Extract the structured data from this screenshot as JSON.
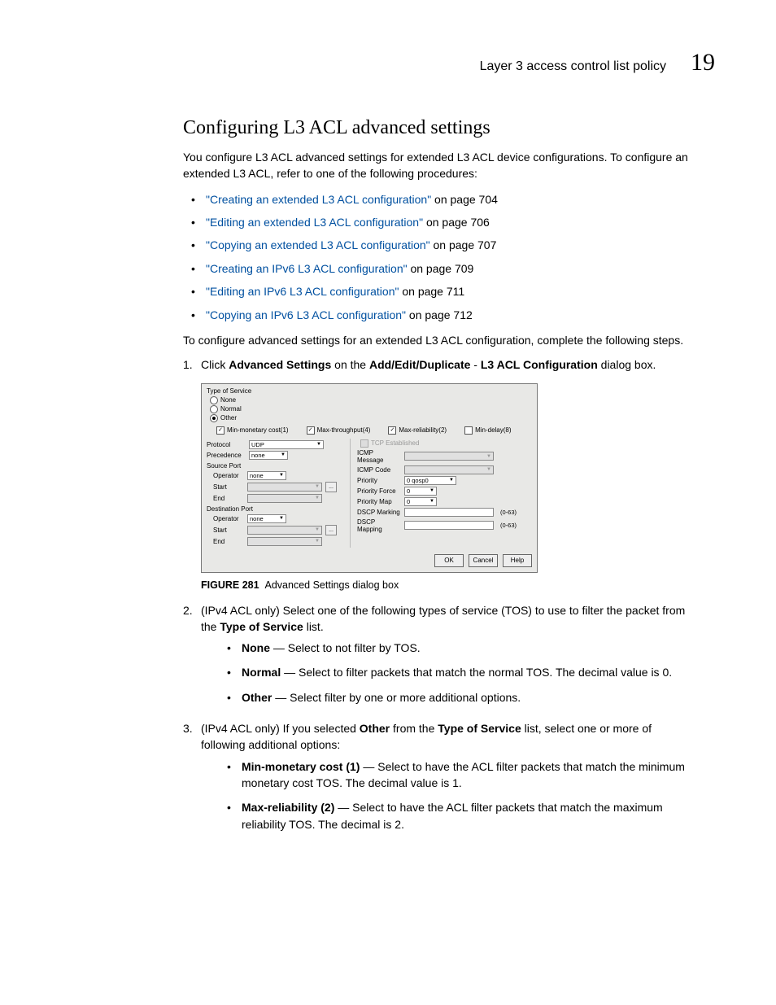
{
  "header": {
    "section": "Layer 3 access control list policy",
    "chapter": "19"
  },
  "heading": "Configuring L3 ACL advanced settings",
  "intro": "You configure L3 ACL advanced settings for extended L3 ACL device configurations. To configure an extended L3 ACL, refer to one of the following procedures:",
  "links": [
    {
      "text": "\"Creating an extended L3 ACL configuration\"",
      "suffix": " on page 704"
    },
    {
      "text": "\"Editing an extended L3 ACL configuration\"",
      "suffix": " on page 706"
    },
    {
      "text": "\"Copying an extended L3 ACL configuration\"",
      "suffix": " on page 707"
    },
    {
      "text": "\"Creating an IPv6 L3 ACL configuration\"",
      "suffix": " on page 709"
    },
    {
      "text": "\"Editing an IPv6 L3 ACL configuration\"",
      "suffix": " on page 711"
    },
    {
      "text": "\"Copying an IPv6 L3 ACL configuration\"",
      "suffix": " on page 712"
    }
  ],
  "lead2": "To configure advanced settings for an extended L3 ACL configuration, complete the following steps.",
  "step1": {
    "num": "1.",
    "pre": "Click ",
    "b1": "Advanced Settings",
    "mid": " on the ",
    "b2": "Add/Edit/Duplicate",
    "sep": " - ",
    "b3": "L3 ACL Configuration",
    "post": " dialog box."
  },
  "dialog": {
    "tos_title": "Type of Service",
    "radios": {
      "none": "None",
      "normal": "Normal",
      "other": "Other"
    },
    "checks": {
      "c1": "Min-monetary cost(1)",
      "c2": "Max-throughput(4)",
      "c3": "Max-reliability(2)",
      "c4": "Min-delay(8)"
    },
    "left": {
      "protocol": "Protocol",
      "protocol_val": "UDP",
      "precedence": "Precedence",
      "precedence_val": "none",
      "source_port": "Source Port",
      "operator": "Operator",
      "operator_val": "none",
      "start": "Start",
      "end": "End",
      "dest_port": "Destination Port"
    },
    "right": {
      "tcp": "TCP Established",
      "icmp_msg": "ICMP Message",
      "icmp_code": "ICMP Code",
      "priority": "Priority",
      "priority_val": "0 qosp0",
      "priority_force": "Priority Force",
      "pf_val": "0",
      "priority_map": "Priority Map",
      "pm_val": "0",
      "dscp_marking": "DSCP Marking",
      "dscp_mapping": "DSCP Mapping",
      "range": "(0-63)"
    },
    "buttons": {
      "ok": "OK",
      "cancel": "Cancel",
      "help": "Help"
    }
  },
  "figure": {
    "label": "FIGURE 281",
    "caption": "Advanced Settings dialog box"
  },
  "step2": {
    "num": "2.",
    "text_a": "(IPv4 ACL only) Select one of the following types of service (TOS) to use to filter the packet from the ",
    "bold": "Type of Service",
    "text_b": " list.",
    "items": [
      {
        "b": "None",
        "t": " — Select to not filter by TOS."
      },
      {
        "b": "Normal",
        "t": " — Select to filter packets that match the normal TOS. The decimal value is 0."
      },
      {
        "b": "Other",
        "t": " — Select filter by one or more additional options."
      }
    ]
  },
  "step3": {
    "num": "3.",
    "text_a": "(IPv4 ACL only) If you selected ",
    "bold1": "Other",
    "text_b": " from the ",
    "bold2": "Type of Service",
    "text_c": " list, select one or more of following additional options:",
    "items": [
      {
        "b": "Min-monetary cost (1)",
        "t": " — Select to have the ACL filter packets that match the minimum monetary cost TOS. The decimal value is 1."
      },
      {
        "b": "Max-reliability (2)",
        "t": " — Select to have the ACL filter packets that match the maximum reliability TOS. The decimal is 2."
      }
    ]
  }
}
